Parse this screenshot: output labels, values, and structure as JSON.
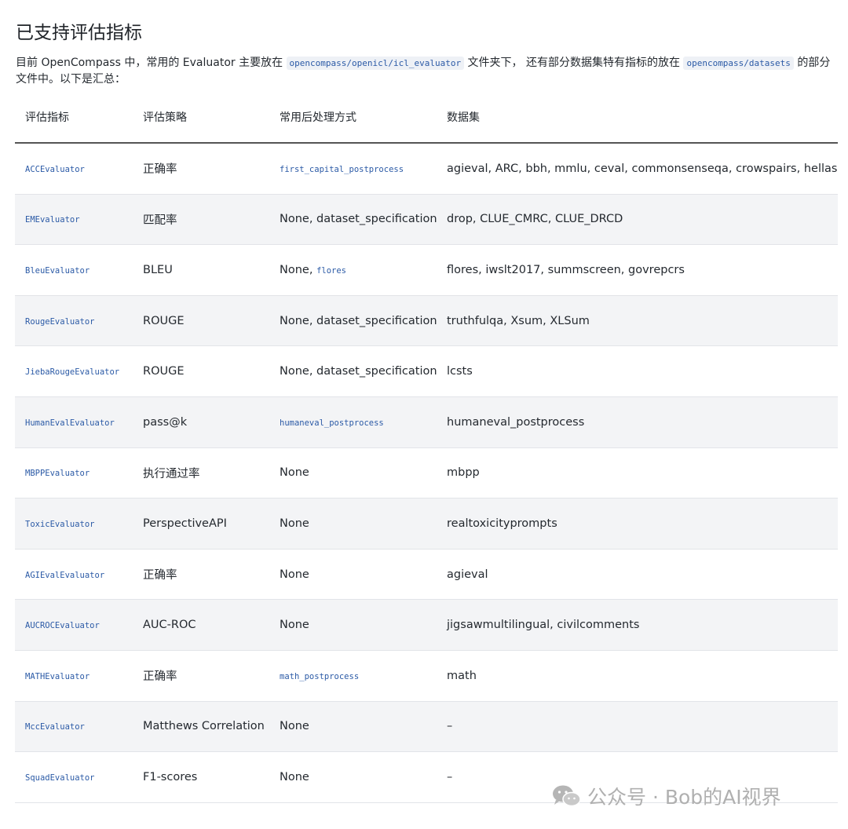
{
  "heading": "已支持评估指标",
  "intro": {
    "part1": "目前 OpenCompass 中，常用的 Evaluator 主要放在 ",
    "code1": "opencompass/openicl/icl_evaluator",
    "part2": " 文件夹下， 还有部分数据集特有指标的放在 ",
    "code2": "opencompass/datasets",
    "part3": " 的部分文件中。以下是汇总："
  },
  "table": {
    "headers": [
      "评估指标",
      "评估策略",
      "常用后处理方式",
      "数据集"
    ],
    "rows": [
      {
        "evaluator": "ACCEvaluator",
        "strategy": "正确率",
        "post_code": "first_capital_postprocess",
        "post_text": "",
        "datasets": "agieval, ARC, bbh, mmlu, ceval, commonsenseqa, crowspairs, hellaswag"
      },
      {
        "evaluator": "EMEvaluator",
        "strategy": "匹配率",
        "post_code": "",
        "post_text": "None, dataset_specification",
        "datasets": "drop, CLUE_CMRC, CLUE_DRCD"
      },
      {
        "evaluator": "BleuEvaluator",
        "strategy": "BLEU",
        "post_code": "flores",
        "post_text": "None, ",
        "datasets": "flores, iwslt2017, summscreen, govrepcrs"
      },
      {
        "evaluator": "RougeEvaluator",
        "strategy": "ROUGE",
        "post_code": "",
        "post_text": "None, dataset_specification",
        "datasets": "truthfulqa, Xsum, XLSum"
      },
      {
        "evaluator": "JiebaRougeEvaluator",
        "strategy": "ROUGE",
        "post_code": "",
        "post_text": "None, dataset_specification",
        "datasets": "lcsts"
      },
      {
        "evaluator": "HumanEvalEvaluator",
        "strategy": "pass@k",
        "post_code": "humaneval_postprocess",
        "post_text": "",
        "datasets": "humaneval_postprocess"
      },
      {
        "evaluator": "MBPPEvaluator",
        "strategy": "执行通过率",
        "post_code": "",
        "post_text": "None",
        "datasets": "mbpp"
      },
      {
        "evaluator": "ToxicEvaluator",
        "strategy": "PerspectiveAPI",
        "post_code": "",
        "post_text": "None",
        "datasets": "realtoxicityprompts"
      },
      {
        "evaluator": "AGIEvalEvaluator",
        "strategy": "正确率",
        "post_code": "",
        "post_text": "None",
        "datasets": "agieval"
      },
      {
        "evaluator": "AUCROCEvaluator",
        "strategy": "AUC-ROC",
        "post_code": "",
        "post_text": "None",
        "datasets": "jigsawmultilingual, civilcomments"
      },
      {
        "evaluator": "MATHEvaluator",
        "strategy": "正确率",
        "post_code": "math_postprocess",
        "post_text": "",
        "datasets": "math"
      },
      {
        "evaluator": "MccEvaluator",
        "strategy": "Matthews Correlation",
        "post_code": "",
        "post_text": "None",
        "datasets": "–"
      },
      {
        "evaluator": "SquadEvaluator",
        "strategy": "F1-scores",
        "post_code": "",
        "post_text": "None",
        "datasets": "–"
      }
    ]
  },
  "watermark": {
    "icon": "wechat-icon",
    "text": "公众号 · Bob的AI视界"
  },
  "colors": {
    "code": "#2b5aa6",
    "row_alt": "#f3f4f6"
  }
}
